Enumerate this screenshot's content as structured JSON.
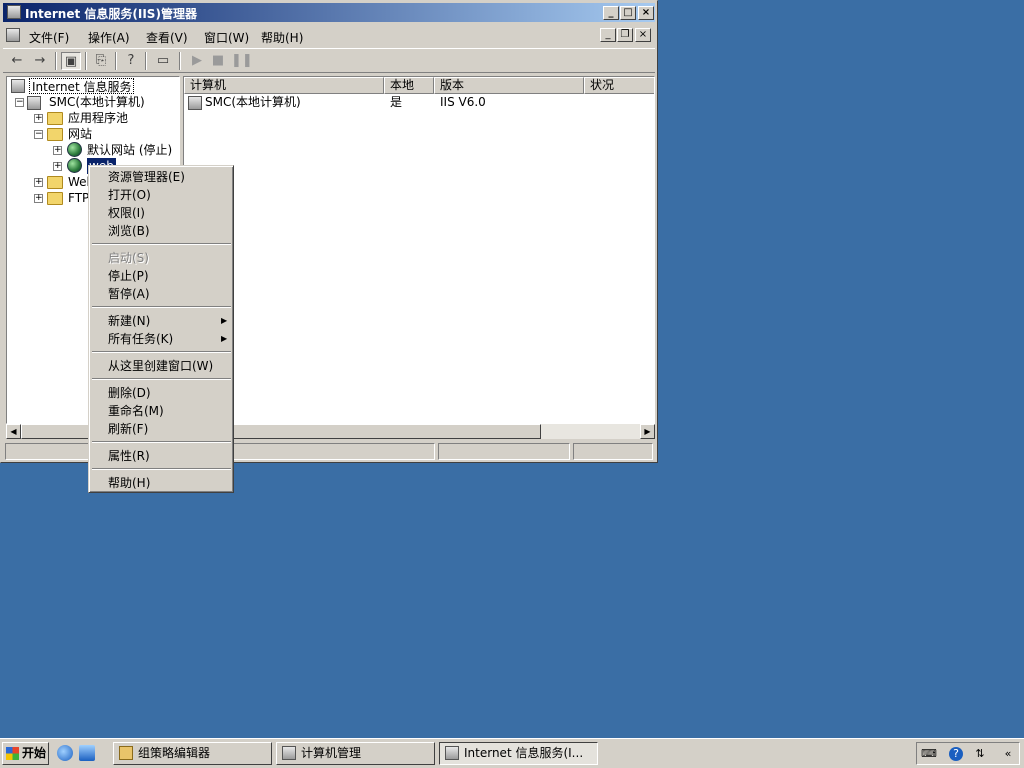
{
  "window": {
    "title": "Internet 信息服务(IIS)管理器",
    "caption_buttons": [
      "minimize-icon",
      "maximize-icon",
      "close-icon"
    ]
  },
  "menubar": {
    "items": [
      "文件(F)",
      "操作(A)",
      "查看(V)",
      "窗口(W)",
      "帮助(H)"
    ]
  },
  "toolbar": {
    "buttons": [
      "back-icon",
      "forward-icon",
      "show-tree-icon",
      "export-icon",
      "help-icon",
      "computer-icon",
      "play-icon",
      "stop-icon",
      "pause-icon"
    ]
  },
  "tree": {
    "root": "Internet 信息服务",
    "computer": "SMC(本地计算机)",
    "app_pools": "应用程序池",
    "websites": "网站",
    "default_site": "默认网站 (停止)",
    "selected_site": "web",
    "web_ext": "Web",
    "ftp": "FTP"
  },
  "list": {
    "columns": [
      "计算机",
      "本地",
      "版本",
      "状况"
    ],
    "rows": [
      {
        "computer": "SMC(本地计算机)",
        "local": "是",
        "version": "IIS V6.0",
        "status": ""
      }
    ]
  },
  "context_menu": {
    "explorer": "资源管理器(E)",
    "open": "打开(O)",
    "permissions": "权限(I)",
    "browse": "浏览(B)",
    "start": "启动(S)",
    "stop": "停止(P)",
    "pause": "暂停(A)",
    "new": "新建(N)",
    "all_tasks": "所有任务(K)",
    "new_window": "从这里创建窗口(W)",
    "delete": "删除(D)",
    "rename": "重命名(M)",
    "refresh": "刷新(F)",
    "properties": "属性(R)",
    "help": "帮助(H)"
  },
  "taskbar": {
    "start": "开始",
    "tasks": [
      "组策略编辑器",
      "计算机管理",
      "Internet 信息服务(I..."
    ],
    "tray_collapse": "«"
  }
}
